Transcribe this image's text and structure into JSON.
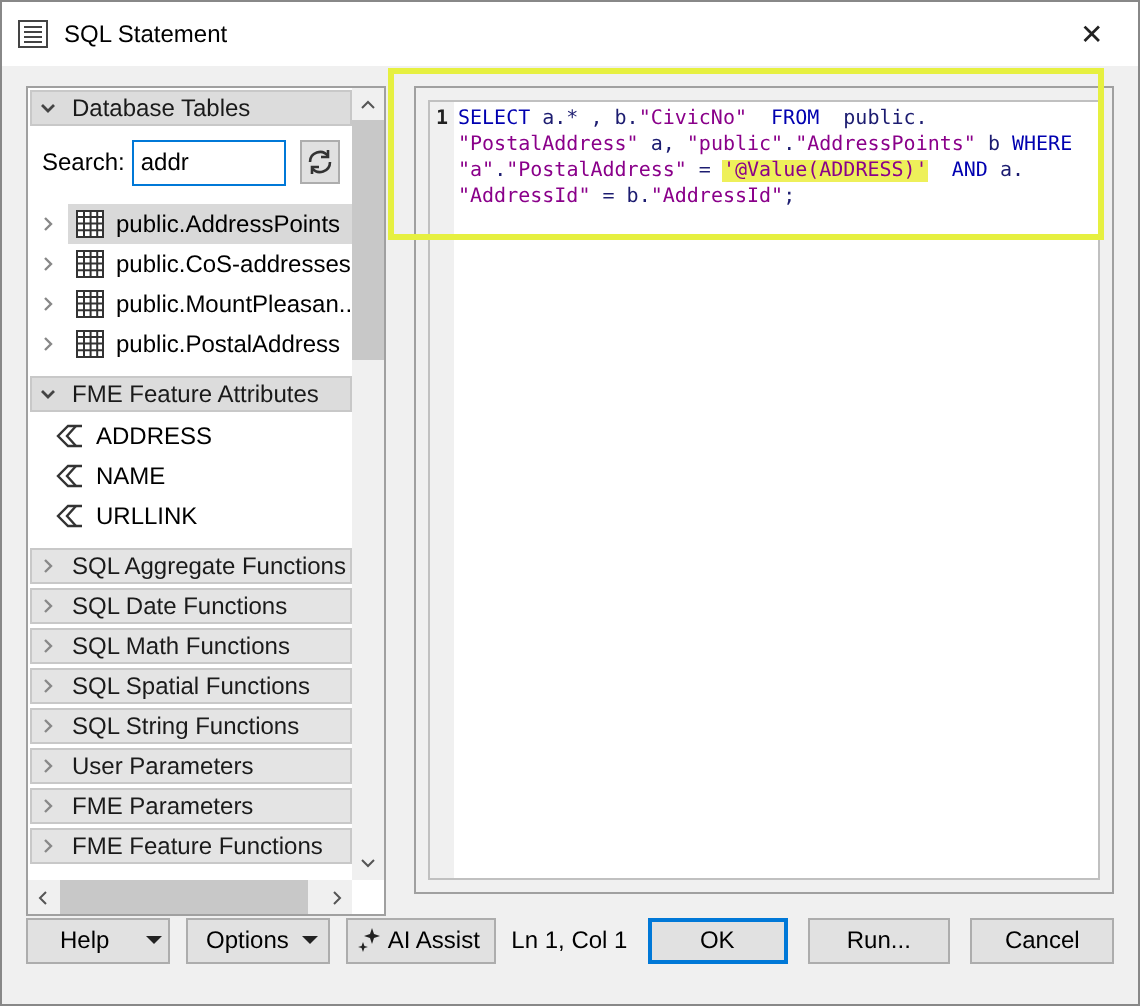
{
  "window": {
    "title": "SQL Statement",
    "close": "✕"
  },
  "sections": [
    {
      "kind": "tables",
      "label": "Database Tables",
      "expanded": true,
      "search": {
        "label": "Search:",
        "value": "addr"
      },
      "items": [
        {
          "label": "public.AddressPoints",
          "selected": true
        },
        {
          "label": "public.CoS-addresses",
          "selected": false
        },
        {
          "label": "public.MountPleasan...",
          "selected": false
        },
        {
          "label": "public.PostalAddress",
          "selected": false
        }
      ]
    },
    {
      "kind": "attributes",
      "label": "FME Feature Attributes",
      "expanded": true,
      "items": [
        {
          "label": "ADDRESS"
        },
        {
          "label": "NAME"
        },
        {
          "label": "URLLINK"
        }
      ]
    },
    {
      "kind": "group",
      "label": "SQL Aggregate Functions",
      "expanded": false
    },
    {
      "kind": "group",
      "label": "SQL Date Functions",
      "expanded": false
    },
    {
      "kind": "group",
      "label": "SQL Math Functions",
      "expanded": false
    },
    {
      "kind": "group",
      "label": "SQL Spatial Functions",
      "expanded": false
    },
    {
      "kind": "group",
      "label": "SQL String Functions",
      "expanded": false
    },
    {
      "kind": "group",
      "label": "User Parameters",
      "expanded": false
    },
    {
      "kind": "group",
      "label": "FME Parameters",
      "expanded": false
    },
    {
      "kind": "group",
      "label": "FME Feature Functions",
      "expanded": false
    }
  ],
  "editor": {
    "line_number": "1",
    "lines": [
      [
        {
          "kind": "keyword",
          "text": "SELECT"
        },
        {
          "kind": "plain",
          "text": " a.* , b."
        },
        {
          "kind": "string",
          "text": "\"CivicNo\""
        },
        {
          "kind": "keyword",
          "text": "  FROM"
        },
        {
          "kind": "plain",
          "text": "  public."
        }
      ],
      [
        {
          "kind": "string",
          "text": "\"PostalAddress\""
        },
        {
          "kind": "plain",
          "text": " a, "
        },
        {
          "kind": "string",
          "text": "\"public\""
        },
        {
          "kind": "plain",
          "text": "."
        },
        {
          "kind": "string",
          "text": "\"AddressPoints\""
        },
        {
          "kind": "plain",
          "text": " b "
        },
        {
          "kind": "keyword",
          "text": "WHERE"
        }
      ],
      [
        {
          "kind": "string",
          "text": "\"a\""
        },
        {
          "kind": "plain",
          "text": "."
        },
        {
          "kind": "string",
          "text": "\"PostalAddress\""
        },
        {
          "kind": "plain",
          "text": " = "
        },
        {
          "kind": "highlight",
          "text": "'@Value(ADDRESS)'"
        },
        {
          "kind": "keyword",
          "text": "  AND"
        },
        {
          "kind": "plain",
          "text": " a."
        }
      ],
      [
        {
          "kind": "string",
          "text": "\"AddressId\""
        },
        {
          "kind": "plain",
          "text": " = b."
        },
        {
          "kind": "string",
          "text": "\"AddressId\""
        },
        {
          "kind": "plain",
          "text": ";"
        }
      ]
    ]
  },
  "footer": {
    "help": "Help",
    "options": "Options",
    "ai": "AI Assist",
    "position": "Ln 1, Col 1",
    "ok": "OK",
    "run": "Run...",
    "cancel": "Cancel"
  }
}
